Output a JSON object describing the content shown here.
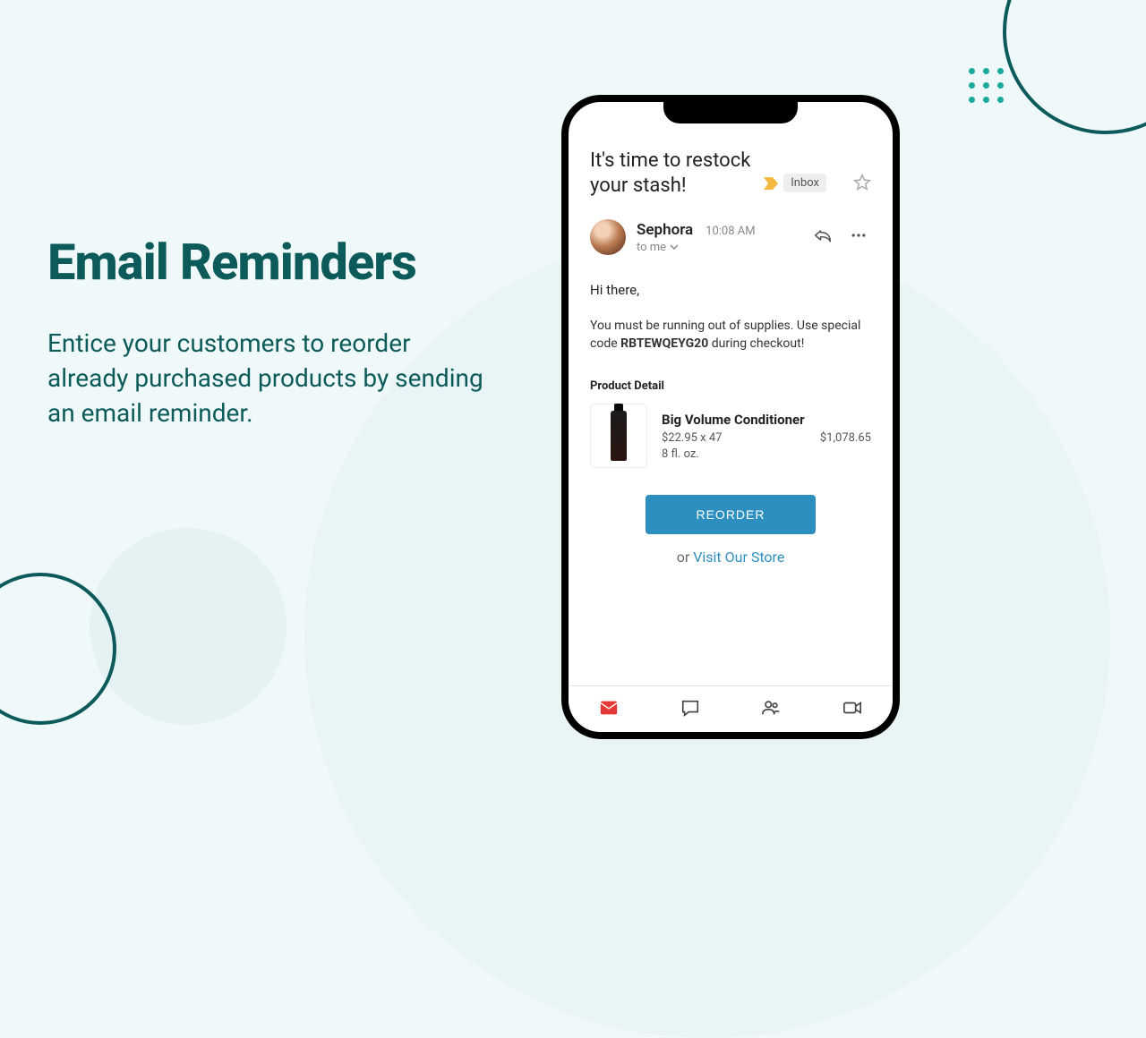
{
  "left": {
    "heading": "Email Reminders",
    "description": "Entice your customers to reorder already purchased products by sending an email reminder."
  },
  "email": {
    "subject": "It's time to restock your stash!",
    "inbox_label": "Inbox",
    "sender_name": "Sephora",
    "sender_time": "10:08 AM",
    "to_label": "to me",
    "greeting": "Hi there,",
    "body_before": "You must be running out of supplies. Use special code ",
    "code": "RBTEWQEYG20",
    "body_after": " during checkout!",
    "detail_header": "Product Detail",
    "product": {
      "name": "Big Volume Conditioner",
      "unit_price": "$22.95 x 47",
      "total": "$1,078.65",
      "size": "8 fl. oz."
    },
    "reorder_label": "REORDER",
    "or_label": "or ",
    "visit_label": "Visit Our Store"
  },
  "colors": {
    "accent": "#0d5a5a",
    "teal": "#1aa89e",
    "button": "#2d8fbf"
  }
}
